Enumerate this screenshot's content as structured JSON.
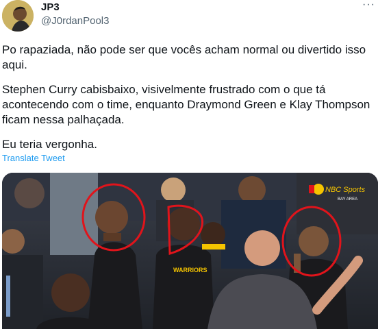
{
  "author": {
    "display_name": "JP3",
    "handle": "@J0rdanPool3",
    "avatar_icon": "avatar-photo"
  },
  "more_label": "···",
  "tweet": {
    "paragraphs": [
      "Po rapaziada, não pode ser que vocês acham normal ou divertido isso aqui.",
      "Stephen Curry cabisbaixo, visivelmente frustrado com o que tá acontecendo com o time, enquanto Draymond Green e Klay Thompson ficam nessa palhaçada.",
      "Eu teria vergonha."
    ],
    "translate_label": "Translate Tweet"
  },
  "media": {
    "watermark": "NBC Sports BAY AREA",
    "jersey_text": "WARRIORS",
    "colors": {
      "circle": "#e0141b",
      "warriors_black": "#1a1a1d",
      "warriors_gold": "#f5c400",
      "link": "#1d9bf0"
    }
  }
}
